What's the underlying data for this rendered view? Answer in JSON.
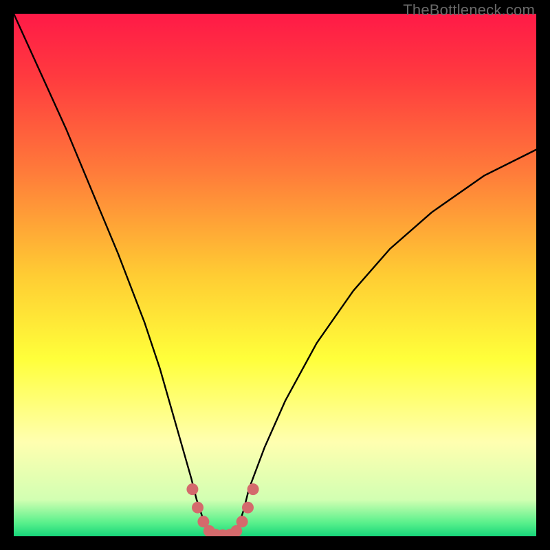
{
  "attribution": "TheBottleneck.com",
  "colors": {
    "frame": "#000000",
    "curve": "#000000",
    "dots": "#d46a6c",
    "gradient_stops": [
      {
        "offset": 0.0,
        "color": "#ff1a47"
      },
      {
        "offset": 0.12,
        "color": "#ff3a3f"
      },
      {
        "offset": 0.3,
        "color": "#ff7a3a"
      },
      {
        "offset": 0.5,
        "color": "#ffcc33"
      },
      {
        "offset": 0.66,
        "color": "#ffff3a"
      },
      {
        "offset": 0.82,
        "color": "#ffffb0"
      },
      {
        "offset": 0.93,
        "color": "#d2ffb2"
      },
      {
        "offset": 0.975,
        "color": "#57f08b"
      },
      {
        "offset": 1.0,
        "color": "#17d57a"
      }
    ]
  },
  "chart_data": {
    "type": "line",
    "title": "",
    "xlabel": "",
    "ylabel": "",
    "x_range": [
      0,
      100
    ],
    "y_range": [
      0,
      100
    ],
    "series": [
      {
        "name": "bottleneck-curve",
        "x": [
          0,
          5,
          10,
          15,
          20,
          25,
          28,
          30,
          32,
          34,
          35,
          36,
          37,
          38,
          39,
          40,
          41,
          42,
          43,
          44,
          45,
          48,
          52,
          58,
          65,
          72,
          80,
          90,
          100
        ],
        "y": [
          100,
          89,
          78,
          66,
          54,
          41,
          32,
          25,
          18,
          11,
          7,
          4,
          2,
          0.5,
          0.2,
          0.2,
          0.3,
          0.5,
          2,
          5,
          9,
          17,
          26,
          37,
          47,
          55,
          62,
          69,
          74
        ]
      }
    ],
    "flat_bottom": {
      "x_start": 37.5,
      "x_end": 42.5,
      "y": 0.2
    },
    "highlight_dots": {
      "name": "bottom-dots",
      "points": [
        {
          "x": 34.2,
          "y": 9.0
        },
        {
          "x": 35.2,
          "y": 5.5
        },
        {
          "x": 36.3,
          "y": 2.8
        },
        {
          "x": 37.4,
          "y": 1.0
        },
        {
          "x": 38.6,
          "y": 0.3
        },
        {
          "x": 40.0,
          "y": 0.2
        },
        {
          "x": 41.4,
          "y": 0.3
        },
        {
          "x": 42.6,
          "y": 1.0
        },
        {
          "x": 43.7,
          "y": 2.8
        },
        {
          "x": 44.8,
          "y": 5.5
        },
        {
          "x": 45.8,
          "y": 9.0
        }
      ]
    }
  }
}
